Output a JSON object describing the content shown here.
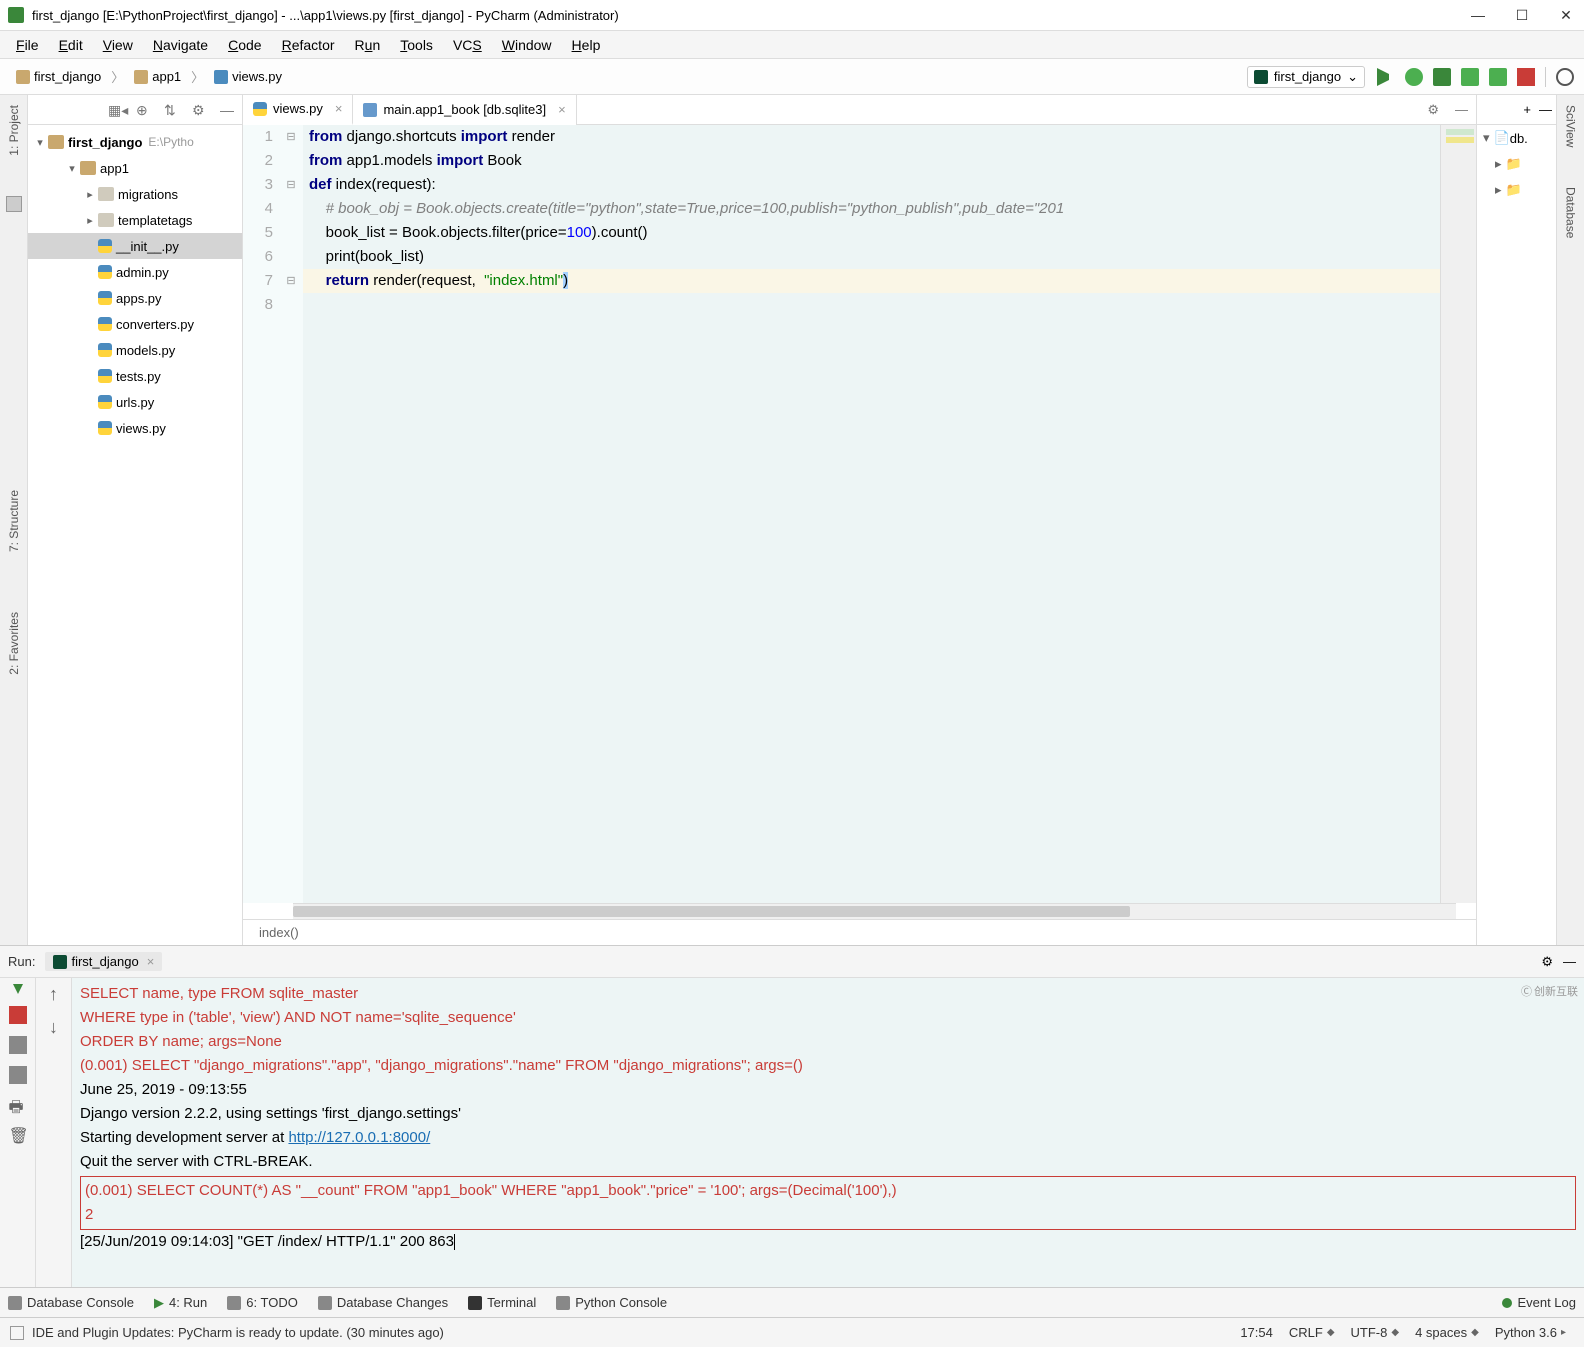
{
  "title": "first_django [E:\\PythonProject\\first_django] - ...\\app1\\views.py [first_django] - PyCharm (Administrator)",
  "menus": [
    "File",
    "Edit",
    "View",
    "Navigate",
    "Code",
    "Refactor",
    "Run",
    "Tools",
    "VCS",
    "Window",
    "Help"
  ],
  "breadcrumb": [
    "first_django",
    "app1",
    "views.py"
  ],
  "run_config": "first_django",
  "project_root": "first_django",
  "project_root_path": "E:\\Pytho",
  "tree": [
    {
      "level": 1,
      "arrow": "▾",
      "icon": "fi",
      "label": "app1"
    },
    {
      "level": 2,
      "arrow": "▸",
      "icon": "fi2",
      "label": "migrations"
    },
    {
      "level": 2,
      "arrow": "▸",
      "icon": "fi2",
      "label": "templatetags"
    },
    {
      "level": 2,
      "arrow": "",
      "icon": "pyi",
      "label": "__init__.py",
      "sel": true
    },
    {
      "level": 2,
      "arrow": "",
      "icon": "pyi",
      "label": "admin.py"
    },
    {
      "level": 2,
      "arrow": "",
      "icon": "pyi",
      "label": "apps.py"
    },
    {
      "level": 2,
      "arrow": "",
      "icon": "pyi",
      "label": "converters.py"
    },
    {
      "level": 2,
      "arrow": "",
      "icon": "pyi",
      "label": "models.py"
    },
    {
      "level": 2,
      "arrow": "",
      "icon": "pyi",
      "label": "tests.py"
    },
    {
      "level": 2,
      "arrow": "",
      "icon": "pyi",
      "label": "urls.py"
    },
    {
      "level": 2,
      "arrow": "",
      "icon": "pyi",
      "label": "views.py"
    }
  ],
  "tabs": [
    {
      "icon": "pyi",
      "label": "views.py",
      "active": true
    },
    {
      "icon": "dbi",
      "label": "main.app1_book [db.sqlite3]",
      "active": false
    }
  ],
  "code": {
    "l1": {
      "a": "from",
      "b": " django.shortcuts ",
      "c": "import",
      "d": " render"
    },
    "l2": {
      "a": "from",
      "b": " app1.models ",
      "c": "import",
      "d": " Book"
    },
    "l3": {
      "a": "def ",
      "b": "index(request):"
    },
    "l4": "    # book_obj = Book.objects.create(title=\"python\",state=True,price=100,publish=\"python_publish\",pub_date=\"201",
    "l5": {
      "a": "    book_list = Book.objects.filter(price=",
      "b": "100",
      "c": ").count()"
    },
    "l6": "    print(book_list)",
    "l7": {
      "a": "    ",
      "b": "return ",
      "c": "render",
      "d": "(request,  ",
      "e": "\"index.html\"",
      "f": ")"
    }
  },
  "breadcrumb_editor": "index()",
  "console": {
    "l1": "    SELECT name, type FROM sqlite_master",
    "l2": "    WHERE type in ('table', 'view') AND NOT name='sqlite_sequence'",
    "l3": "    ORDER BY name; args=None",
    "l4": "(0.001) SELECT \"django_migrations\".\"app\", \"django_migrations\".\"name\" FROM \"django_migrations\"; args=()",
    "l5": "June 25, 2019 - 09:13:55",
    "l6": "Django version 2.2.2, using settings 'first_django.settings'",
    "l7a": "Starting development server at ",
    "l7b": "http://127.0.0.1:8000/",
    "l8": "Quit the server with CTRL-BREAK.",
    "l9": "(0.001) SELECT COUNT(*) AS \"__count\" FROM \"app1_book\" WHERE \"app1_book\".\"price\" = '100'; args=(Decimal('100'),)",
    "l10": "2",
    "l11": "[25/Jun/2019 09:14:03] \"GET /index/ HTTP/1.1\" 200 863"
  },
  "run_tab_label": "Run:",
  "run_tab_name": "first_django",
  "bottom_tabs": [
    "Database Console",
    "4: Run",
    "6: TODO",
    "Database Changes",
    "Terminal",
    "Python Console"
  ],
  "event_log": "Event Log",
  "status_msg": "IDE and Plugin Updates: PyCharm is ready to update. (30 minutes ago)",
  "status_time": "17:54",
  "status_eol": "CRLF",
  "status_enc": "UTF-8",
  "status_indent": "4 spaces",
  "status_py": "Python 3.6",
  "right_items": [
    "db.",
    "",
    ""
  ],
  "side_left": [
    "1: Project",
    "7: Structure",
    "2: Favorites"
  ],
  "side_right": [
    "SciView",
    "Database"
  ],
  "logo": "创新互联"
}
